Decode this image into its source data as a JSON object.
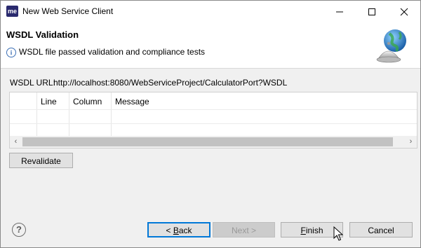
{
  "window": {
    "title": "New Web Service Client",
    "app_icon_text": "me"
  },
  "banner": {
    "title": "WSDL Validation",
    "message": "WSDL file passed validation and compliance tests",
    "info_icon_text": "i"
  },
  "wsdl": {
    "url_label": "WSDL URL:",
    "url_value": "http://localhost:8080/WebServiceProject/CalculatorPort?WSDL"
  },
  "table": {
    "columns": [
      "",
      "Line",
      "Column",
      "Message"
    ],
    "rows": []
  },
  "buttons": {
    "revalidate": "Revalidate",
    "back_prefix": "< ",
    "back_mnemonic": "B",
    "back_rest": "ack",
    "next": "Next >",
    "finish_mnemonic": "F",
    "finish_rest": "inish",
    "cancel": "Cancel",
    "help": "?"
  },
  "icons": {
    "app": "eclipse-me-icon",
    "info": "info-icon",
    "banner": "globe-service-bell-icon",
    "help": "help-icon",
    "cursor": "mouse-pointer-icon"
  },
  "colors": {
    "focus_border": "#0078d7",
    "dialog_bg": "#f0f0f0",
    "info_blue": "#3c6fb5"
  }
}
